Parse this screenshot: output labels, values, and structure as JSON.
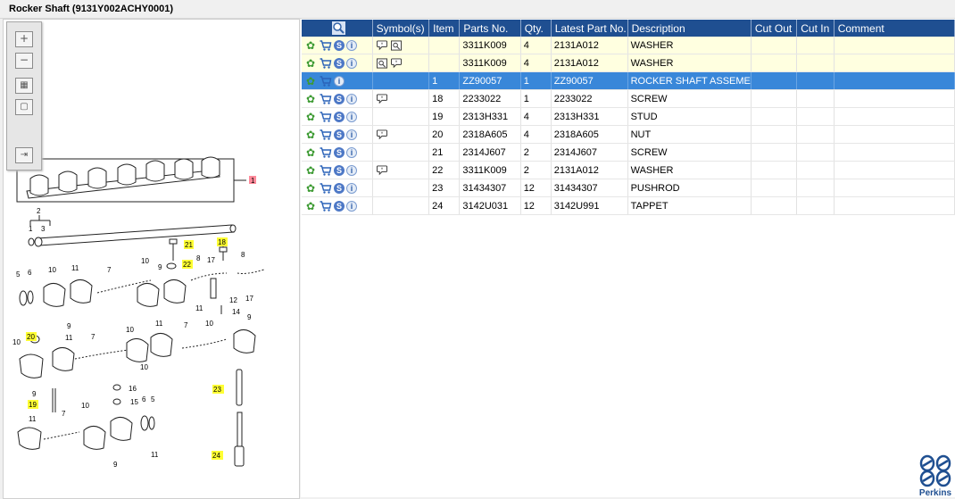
{
  "window": {
    "title": "Rocker Shaft (9131Y002ACHY0001)"
  },
  "toolbox": {
    "zoom_in": "+",
    "zoom_out": "−",
    "fit": "▦",
    "actual": "▢",
    "export": "⇥"
  },
  "diagram": {
    "callouts": {
      "c1": "1",
      "c2": "2",
      "c3": "3",
      "c21": "21",
      "c18": "18",
      "c22": "22",
      "c20": "20",
      "c19": "19",
      "c23": "23",
      "c24": "24",
      "n5a": "5",
      "n6a": "6",
      "n10a": "10",
      "n11a": "11",
      "n7a": "7",
      "n10b": "10",
      "n9a": "9",
      "n8a": "8",
      "n17a": "17",
      "n8b": "8",
      "n12": "12",
      "n17b": "17",
      "n14": "14",
      "n11b": "11",
      "n9b": "9",
      "n10c": "10",
      "n11c": "11",
      "n7b": "7",
      "n10d": "10",
      "n11d": "11",
      "n7c": "7",
      "n10e": "10",
      "n9c": "9",
      "n10f": "10",
      "n9d": "9",
      "n16": "16",
      "n15": "15",
      "n6b": "6",
      "n5b": "5",
      "n11e": "11",
      "n7d": "7",
      "n10g": "10",
      "n9e": "9",
      "n11f": "11"
    }
  },
  "table": {
    "headers": {
      "search_icon": "magnifier-icon",
      "symbols": "Symbol(s)",
      "item": "Item",
      "parts_no": "Parts No.",
      "qty": "Qty.",
      "latest_part_no": "Latest Part No.",
      "description": "Description",
      "cut_out": "Cut Out",
      "cut_in": "Cut In",
      "comment": "Comment"
    },
    "rows": [
      {
        "item": "",
        "parts_no": "3311K009",
        "qty": "4",
        "latest": "2131A012",
        "description": "WASHER",
        "cut_out": "",
        "cut_in": "",
        "comment": ""
      },
      {
        "item": "",
        "parts_no": "3311K009",
        "qty": "4",
        "latest": "2131A012",
        "description": "WASHER",
        "cut_out": "",
        "cut_in": "",
        "comment": ""
      },
      {
        "item": "1",
        "parts_no": "ZZ90057",
        "qty": "1",
        "latest": "ZZ90057",
        "description": "ROCKER SHAFT ASSEME",
        "cut_out": "",
        "cut_in": "",
        "comment": ""
      },
      {
        "item": "18",
        "parts_no": "2233022",
        "qty": "1",
        "latest": "2233022",
        "description": "SCREW",
        "cut_out": "",
        "cut_in": "",
        "comment": ""
      },
      {
        "item": "19",
        "parts_no": "2313H331",
        "qty": "4",
        "latest": "2313H331",
        "description": "STUD",
        "cut_out": "",
        "cut_in": "",
        "comment": ""
      },
      {
        "item": "20",
        "parts_no": "2318A605",
        "qty": "4",
        "latest": "2318A605",
        "description": "NUT",
        "cut_out": "",
        "cut_in": "",
        "comment": ""
      },
      {
        "item": "21",
        "parts_no": "2314J607",
        "qty": "2",
        "latest": "2314J607",
        "description": "SCREW",
        "cut_out": "",
        "cut_in": "",
        "comment": ""
      },
      {
        "item": "22",
        "parts_no": "3311K009",
        "qty": "2",
        "latest": "2131A012",
        "description": "WASHER",
        "cut_out": "",
        "cut_in": "",
        "comment": ""
      },
      {
        "item": "23",
        "parts_no": "31434307",
        "qty": "12",
        "latest": "31434307",
        "description": "PUSHROD",
        "cut_out": "",
        "cut_in": "",
        "comment": ""
      },
      {
        "item": "24",
        "parts_no": "3142U031",
        "qty": "12",
        "latest": "3142U991",
        "description": "TAPPET",
        "cut_out": "",
        "cut_in": "",
        "comment": ""
      }
    ],
    "icons": {
      "gear": "✿",
      "s": "S",
      "i": "i"
    }
  },
  "brand": {
    "name": "Perkins"
  },
  "colors": {
    "header_bg": "#1f4f91",
    "selected_row": "#3987d9",
    "highlight_row": "#ffffe0",
    "callout_yellow": "#ffff33",
    "callout_red": "#ff8a9a"
  }
}
